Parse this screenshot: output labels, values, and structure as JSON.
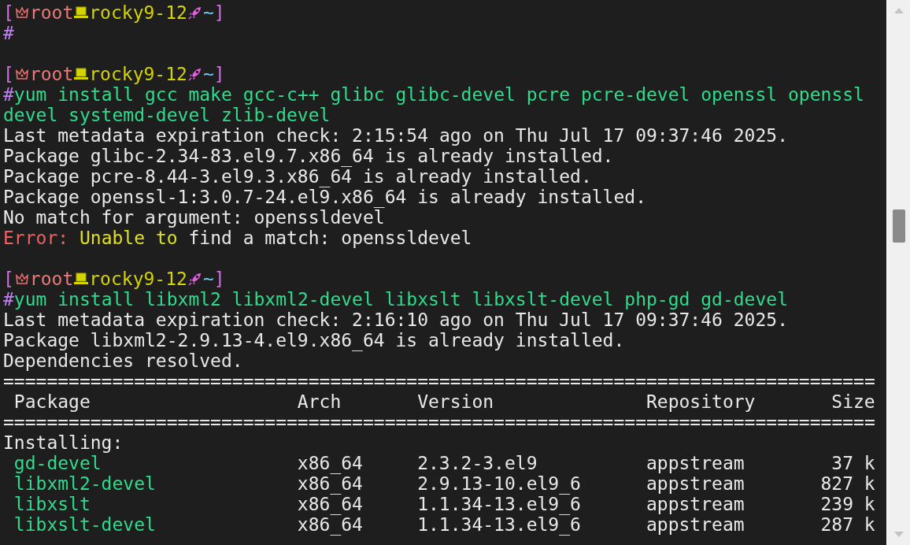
{
  "lines": [
    {
      "kind": "prompt",
      "open": "[",
      "user": "root",
      "host": "rocky9-12",
      "dir": "~",
      "close": "]"
    },
    {
      "kind": "command",
      "symbol": "#"
    },
    {
      "kind": "blank"
    },
    {
      "kind": "prompt",
      "open": "[",
      "user": "root",
      "host": "rocky9-12",
      "dir": "~",
      "close": "]"
    },
    {
      "kind": "command",
      "symbol": "#",
      "text": "yum install gcc make gcc-c++ glibc glibc-devel pcre pcre-devel openssl openssl"
    },
    {
      "kind": "wrap",
      "text": "devel systemd-devel zlib-devel"
    },
    {
      "kind": "output",
      "text": "Last metadata expiration check: 2:15:54 ago on Thu Jul 17 09:37:46 2025."
    },
    {
      "kind": "output",
      "text": "Package glibc-2.34-83.el9.7.x86_64 is already installed."
    },
    {
      "kind": "output",
      "text": "Package pcre-8.44-3.el9.3.x86_64 is already installed."
    },
    {
      "kind": "output",
      "text": "Package openssl-1:3.0.7-24.el9.x86_64 is already installed."
    },
    {
      "kind": "output",
      "text": "No match for argument: openssldevel"
    },
    {
      "kind": "error",
      "label": "Error:",
      "message": "Unable to",
      "detail": "find a match: openssldevel"
    },
    {
      "kind": "blank"
    },
    {
      "kind": "prompt",
      "open": "[",
      "user": "root",
      "host": "rocky9-12",
      "dir": "~",
      "close": "]"
    },
    {
      "kind": "command",
      "symbol": "#",
      "text": "yum install libxml2 libxml2-devel libxslt libxslt-devel php-gd gd-devel"
    },
    {
      "kind": "output",
      "text": "Last metadata expiration check: 2:16:10 ago on Thu Jul 17 09:37:46 2025."
    },
    {
      "kind": "output",
      "text": "Package libxml2-2.9.13-4.el9.x86_64 is already installed."
    },
    {
      "kind": "output",
      "text": "Dependencies resolved."
    },
    {
      "kind": "rule",
      "text": "================================================================================"
    },
    {
      "kind": "header",
      "cells": [
        "Package",
        "Arch",
        "Version",
        "Repository",
        "Size"
      ]
    },
    {
      "kind": "rule",
      "text": "================================================================================"
    },
    {
      "kind": "section",
      "text": "Installing:"
    },
    {
      "kind": "row",
      "cells": [
        "gd-devel",
        "x86_64",
        "2.3.2-3.el9",
        "appstream",
        "37 k"
      ]
    },
    {
      "kind": "row",
      "cells": [
        "libxml2-devel",
        "x86_64",
        "2.9.13-10.el9_6",
        "appstream",
        "827 k"
      ]
    },
    {
      "kind": "row",
      "cells": [
        "libxslt",
        "x86_64",
        "1.1.34-13.el9_6",
        "appstream",
        "239 k"
      ]
    },
    {
      "kind": "row",
      "cells": [
        "libxslt-devel",
        "x86_64",
        "1.1.34-13.el9_6",
        "appstream",
        "287 k"
      ]
    }
  ]
}
